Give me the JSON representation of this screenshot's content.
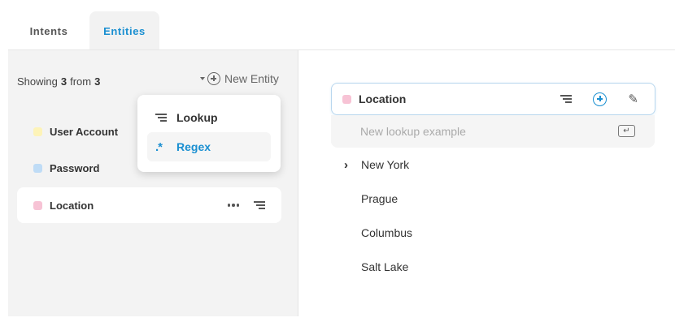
{
  "tabs": [
    {
      "label": "Intents",
      "active": false
    },
    {
      "label": "Entities",
      "active": true
    }
  ],
  "sidebar": {
    "showing_prefix": "Showing",
    "showing_count": "3",
    "showing_from": "from",
    "showing_total": "3",
    "new_entity_label": "New Entity",
    "entities": [
      {
        "name": "User Account",
        "color": "#fdf3b8"
      },
      {
        "name": "Password",
        "color": "#bfdcf6"
      },
      {
        "name": "Location",
        "color": "#f7c3d5",
        "selected": true
      }
    ]
  },
  "dropdown": {
    "items": [
      {
        "label": "Lookup",
        "icon": "lines-icon"
      },
      {
        "label": "Regex",
        "icon": "regex-icon",
        "highlighted": true
      }
    ]
  },
  "editor": {
    "entity_name": "Location",
    "entity_color": "#f7c3d5",
    "new_example_placeholder": "New lookup example",
    "examples": [
      "New York",
      "Prague",
      "Columbus",
      "Salt Lake"
    ]
  },
  "colors": {
    "accent": "#1a8fd1",
    "panel_bg": "#f3f3f3"
  }
}
